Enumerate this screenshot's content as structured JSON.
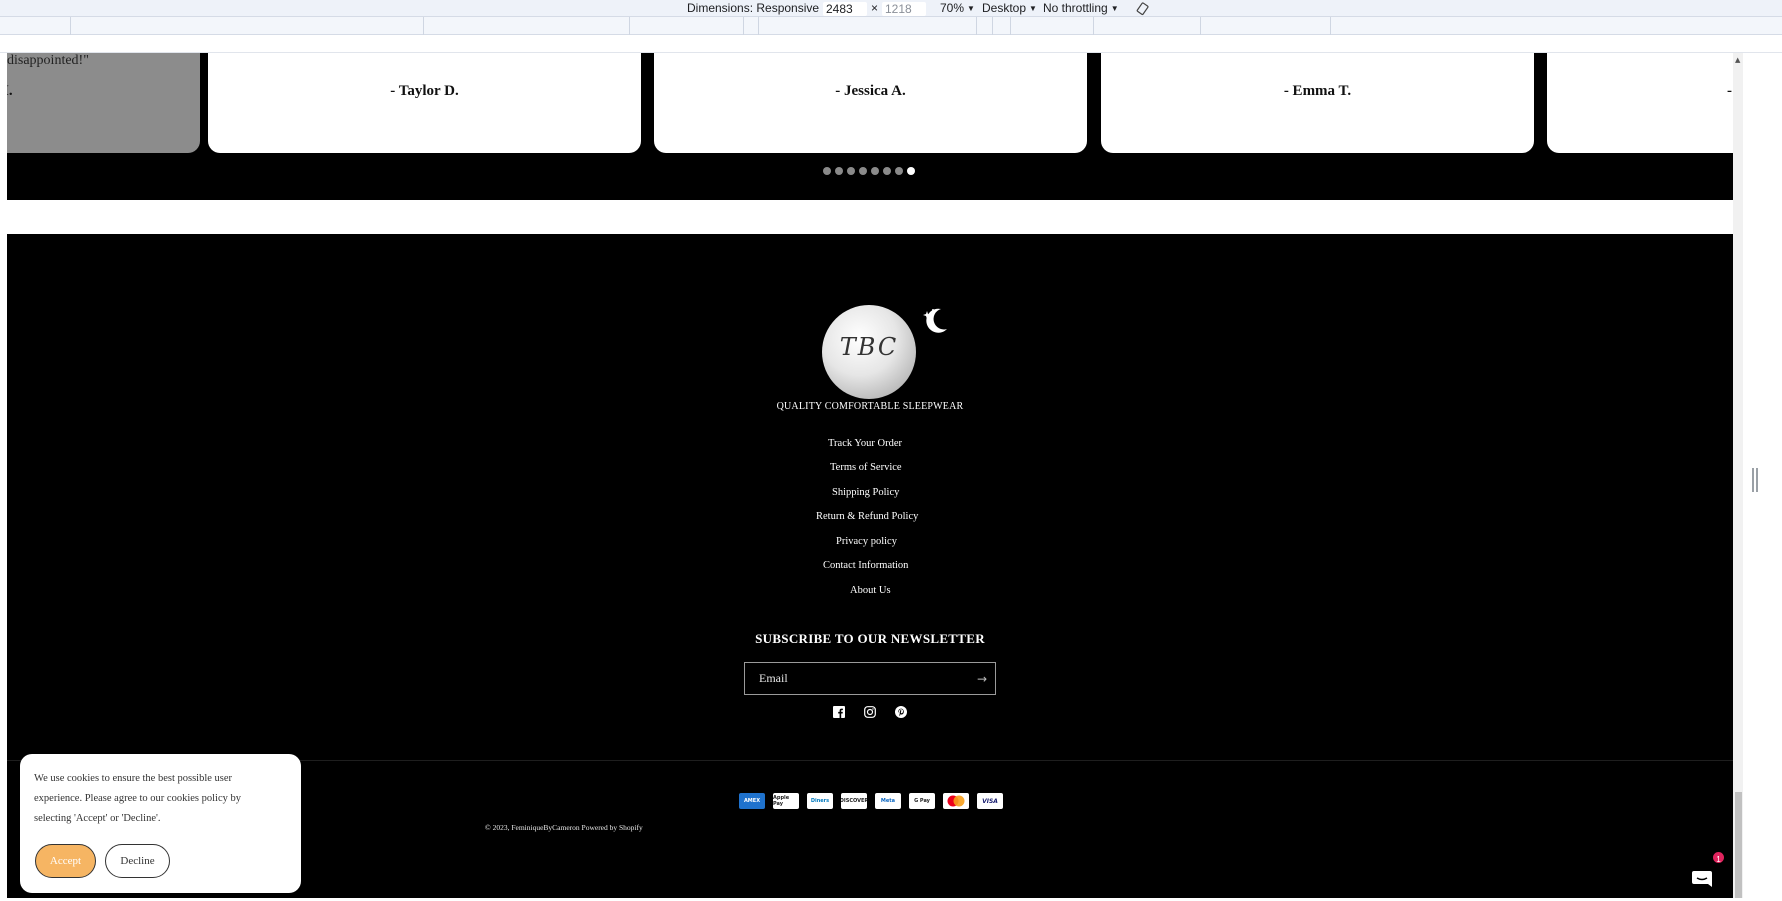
{
  "devtools": {
    "dimensions_label": "Dimensions: Responsive",
    "width": "2483",
    "times": "×",
    "height": "1218",
    "zoom": "70%",
    "device": "Desktop",
    "throttling": "No throttling"
  },
  "testimonials": {
    "partial_quote": "disappointed!\"",
    "partial_author": "I.",
    "cards": [
      {
        "author": "- Taylor D."
      },
      {
        "author": "- Jessica A."
      },
      {
        "author": "- Emma T."
      },
      {
        "author": "- I"
      }
    ],
    "dots_count": 8,
    "active_dot": 7
  },
  "footer": {
    "logo_monogram": "TBC",
    "logo_tagline": "QUALITY COMFORTABLE SLEEPWEAR",
    "links": [
      "Track Your Order",
      "Terms of Service",
      "Shipping Policy",
      "Return & Refund Policy",
      "Privacy policy",
      "Contact Information",
      "About Us"
    ],
    "newsletter_title": "SUBSCRIBE TO OUR NEWSLETTER",
    "email_placeholder": "Email",
    "socials": [
      "facebook-icon",
      "instagram-icon",
      "pinterest-icon"
    ],
    "payments": [
      "AMEX",
      "Apple Pay",
      "Diners",
      "DISCOVER",
      "Meta",
      "G Pay",
      "Mastercard",
      "VISA"
    ],
    "copyright": "© 2023, FeminiqueByCameron Powered by Shopify"
  },
  "cookie": {
    "text": "We use cookies to ensure the best possible user experience. Please agree to our cookies policy by selecting 'Accept' or 'Decline'.",
    "accept": "Accept",
    "decline": "Decline"
  },
  "chat": {
    "badge": "1"
  },
  "colors": {
    "accept_button": "#f6b563",
    "footer_bg": "#000000",
    "badge": "#e0245e"
  }
}
